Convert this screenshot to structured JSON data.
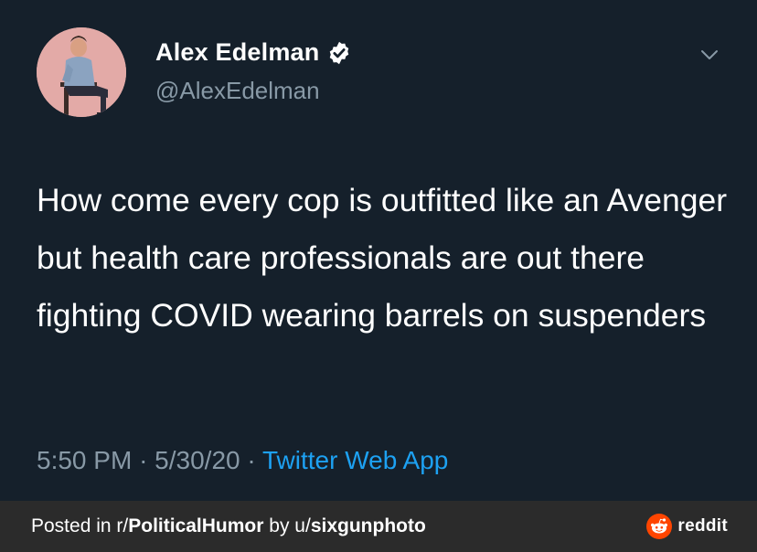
{
  "tweet": {
    "author": {
      "name": "Alex Edelman",
      "handle": "@AlexEdelman",
      "verified": true
    },
    "text": "How come every cop is outfitted like an Avenger but health care professionals are out there fighting COVID wearing barrels on suspenders",
    "time": "5:50 PM",
    "date": "5/30/20",
    "source": "Twitter Web App",
    "separator": "·"
  },
  "icons": [
    "avatar",
    "verified-badge-icon",
    "chevron-down-icon",
    "reddit-logo-icon"
  ],
  "footer": {
    "prefix": "Posted in ",
    "subreddit_prefix": "r/",
    "subreddit": "PoliticalHumor",
    "by": " by ",
    "user_prefix": "u/",
    "user": "sixgunphoto",
    "brand": "reddit"
  },
  "colors": {
    "background": "#15202b",
    "text": "#ffffff",
    "muted": "#8899a6",
    "link": "#1da1f2",
    "footer_bg": "#2b2b2b",
    "reddit_orange": "#ff4500"
  }
}
